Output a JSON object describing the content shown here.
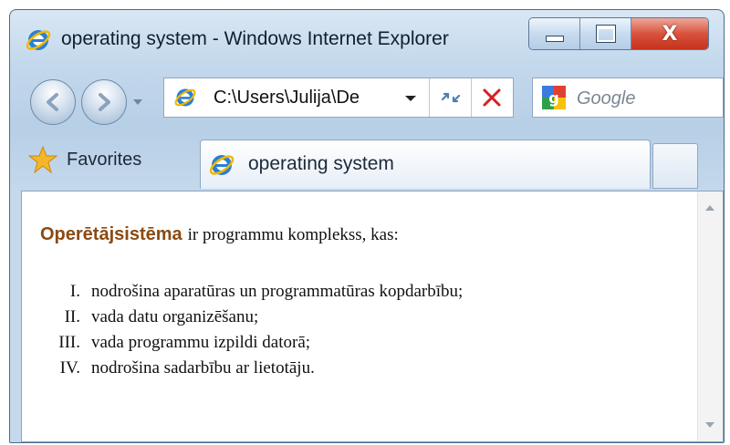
{
  "window": {
    "title": "operating system - Windows Internet Explorer"
  },
  "caption_buttons": {
    "minimize": "minimize",
    "maximize": "maximize",
    "close": "X"
  },
  "navigation": {
    "address": "C:\\Users\\Julija\\De",
    "search_placeholder": "Google"
  },
  "favorites_bar": {
    "favorites_label": "Favorites",
    "tab_label": "operating system"
  },
  "content": {
    "term": "Operētājsistēma",
    "intro": "ir programmu komplekss, kas:",
    "items": [
      {
        "num": "I.",
        "text": "nodrošina aparatūras un programmatūras kopdarbību;"
      },
      {
        "num": "II.",
        "text": "vada datu organizēšanu;"
      },
      {
        "num": "III.",
        "text": "vada programmu izpildi datorā;"
      },
      {
        "num": "IV.",
        "text": "nodrošina sadarbību ar lietotāju."
      }
    ]
  },
  "colors": {
    "term": "#8b4a12",
    "close_button": "#d9533d",
    "stop_icon": "#d42020"
  }
}
